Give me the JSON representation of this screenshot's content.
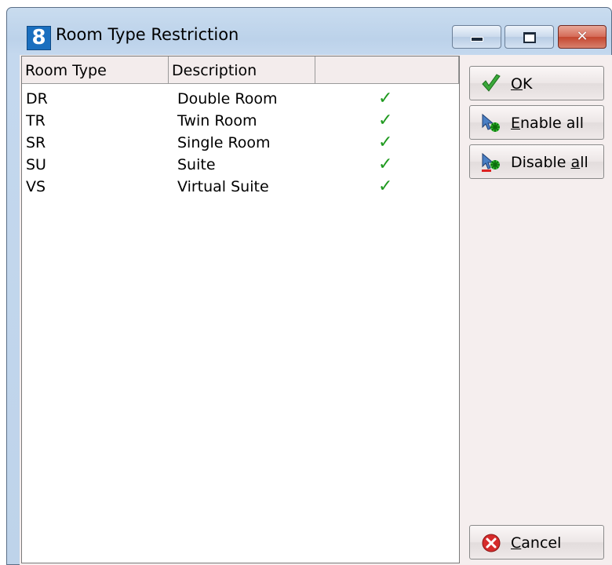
{
  "window": {
    "app_icon_text": "8",
    "title": "Room Type Restriction",
    "controls": {
      "minimize": "minimize",
      "maximize": "maximize",
      "close": "✕"
    }
  },
  "table": {
    "columns": [
      "Room Type",
      "Description",
      ""
    ],
    "rows": [
      {
        "code": "DR",
        "description": "Double Room",
        "enabled": "✓"
      },
      {
        "code": "TR",
        "description": "Twin Room",
        "enabled": "✓"
      },
      {
        "code": "SR",
        "description": "Single Room",
        "enabled": "✓"
      },
      {
        "code": "SU",
        "description": "Suite",
        "enabled": "✓"
      },
      {
        "code": "VS",
        "description": "Virtual Suite",
        "enabled": "✓"
      }
    ]
  },
  "buttons": {
    "ok": {
      "mnemonic": "O",
      "rest": "K",
      "icon": "green-checkmark-icon"
    },
    "enable_all": {
      "mnemonic": "E",
      "rest": "nable all",
      "icon": "enable-cursor-icon"
    },
    "disable_all": {
      "prefix": "Disable ",
      "mnemonic": "a",
      "rest": "ll",
      "icon": "disable-cursor-icon"
    },
    "cancel": {
      "mnemonic": "C",
      "rest": "ancel",
      "icon": "red-x-circle-icon"
    }
  },
  "colors": {
    "check": "#1f9a1f",
    "panel": "#f5eeee",
    "titlebar": "#bed3ea",
    "close": "#c4462f"
  }
}
